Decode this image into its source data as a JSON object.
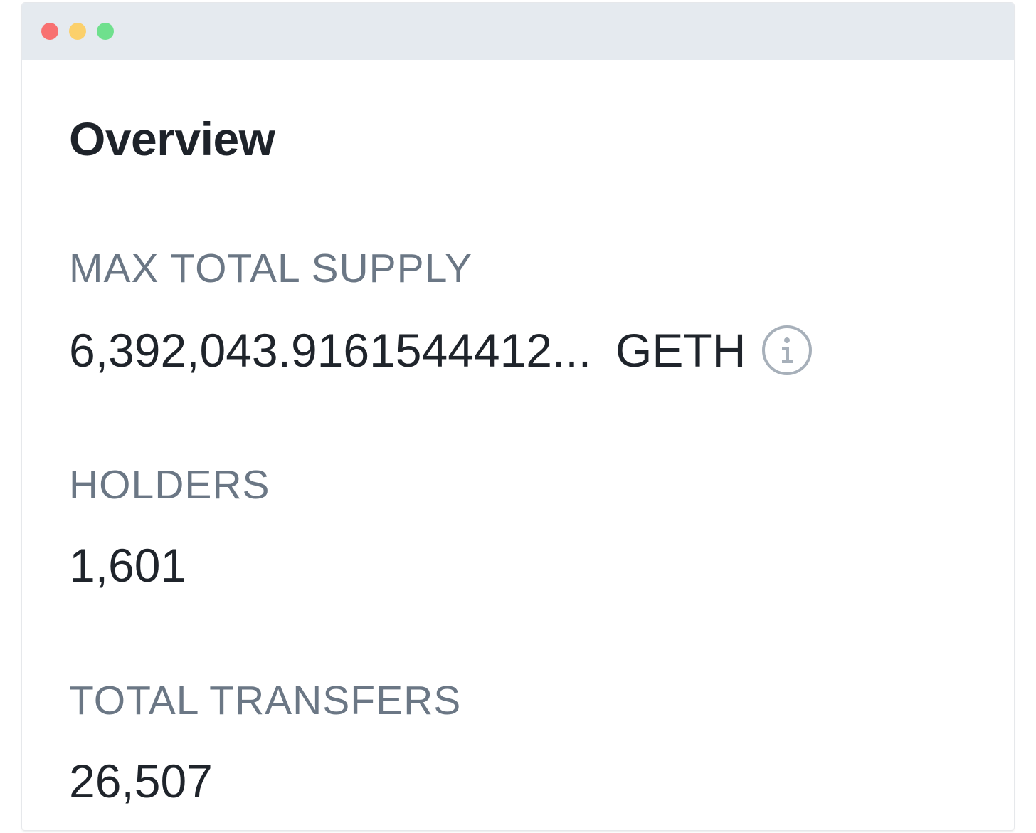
{
  "window": {
    "controls": [
      "close",
      "minimize",
      "maximize"
    ]
  },
  "overview": {
    "title": "Overview",
    "max_total_supply": {
      "label": "MAX TOTAL SUPPLY",
      "value": "6,392,043.9161544412...",
      "unit": "GETH",
      "icon": "info-icon"
    },
    "holders": {
      "label": "HOLDERS",
      "value": "1,601"
    },
    "total_transfers": {
      "label": "TOTAL TRANSFERS",
      "value": "26,507"
    }
  },
  "colors": {
    "titlebar": "#e5eaef",
    "close": "#f87171",
    "minimize": "#fbd06b",
    "maximize": "#6fe08d",
    "label": "#6b7785",
    "value": "#1f242b",
    "icon": "#a7b0ba"
  }
}
